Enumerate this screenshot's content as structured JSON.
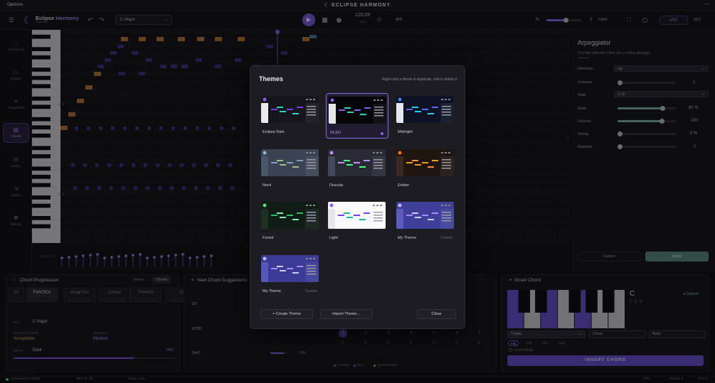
{
  "titlebar": {
    "menu": "Options",
    "title": "ECLIPSE HARMONY",
    "window_controls": "—"
  },
  "toolbar": {
    "app_name_1": "Eclipse",
    "app_name_2": "Harmony",
    "key_select": "C Major",
    "tempo": "120.00",
    "tempo_unit": "BPM",
    "time_signature": "4/4",
    "daw_label": "DAW",
    "vst_label": "VST",
    "sf2_label": "SF2",
    "volume": 0.55
  },
  "sidebar": {
    "items": [
      {
        "label": "Chord Bud",
        "icon": "music-note-icon"
      },
      {
        "label": "Explore",
        "icon": "folder-icon"
      },
      {
        "label": "Progression",
        "icon": "shuffle-icon"
      },
      {
        "label": "Chords",
        "icon": "chords-icon",
        "active": true
      },
      {
        "label": "Scales",
        "icon": "scales-icon"
      },
      {
        "label": "Export",
        "icon": "export-icon"
      },
      {
        "label": "Settings",
        "icon": "gear-icon"
      }
    ]
  },
  "piano_roll": {
    "c_labels": [
      "C4",
      "C3"
    ],
    "velocity_label": "VELOCITY"
  },
  "arpeggiator": {
    "title": "Arpeggiator",
    "subtitle": "Turn the selected chord into a rolling arpeggio.",
    "direction": {
      "label": "Direction",
      "value": "Up"
    },
    "octaves": {
      "label": "Octaves",
      "value": "1",
      "level": 0.0
    },
    "rate": {
      "label": "Rate",
      "value": "1/16"
    },
    "gate": {
      "label": "Gate",
      "value": "80 %",
      "level": 0.8
    },
    "velocity": {
      "label": "Velocity",
      "value": "100",
      "level": 0.79
    },
    "swing": {
      "label": "Swing",
      "value": "0 %",
      "level": 0.0
    },
    "repeats": {
      "label": "Repeats",
      "value": "1",
      "level": 0.0
    },
    "cancel": "Cancel",
    "apply": "Apply"
  },
  "progression": {
    "title": "Chord Progression",
    "tab_voices": "Voices",
    "tab_chords": "Chords",
    "chords": [
      "C#",
      "F#m7/C#",
      "Amaj7/C#",
      "C#sus",
      "F#m/C#",
      "D"
    ],
    "key_label": "KEY",
    "key_value": "C Major",
    "voice_leading_label": "VOICE LEADING",
    "voice_leading_value": "Acceptable",
    "tension_label": "TENSION",
    "tension_value": "Medium",
    "mode_label": "MODE",
    "mode_value": "Dark",
    "mode_pct": "74%",
    "mode_level": 0.74
  },
  "suggestions": {
    "title": "Next Chord Suggestions",
    "rows": [
      {
        "chord": "G7",
        "pct": ""
      },
      {
        "chord": "G7/D",
        "pct": ""
      },
      {
        "chord": "Dm7",
        "pct": "76%",
        "level": 0.76
      }
    ],
    "degrees": [
      "1",
      "2",
      "3",
      "4",
      "5",
      "6",
      "7"
    ],
    "notes": [
      "C",
      "D",
      "E",
      "F",
      "G",
      "A",
      "B"
    ],
    "legend": [
      "In Scale",
      "Root",
      "Selected Note"
    ]
  },
  "smart_chord": {
    "title": "Smart Chord",
    "root": "C",
    "notes": "C E G",
    "diatonic": "Diatonic",
    "type_select": "Triads",
    "voicing_select": "Close",
    "inversion_select": "Root",
    "qualities": [
      "maj",
      "min",
      "dim",
      "aug"
    ],
    "insert_mode": "Insert Mode",
    "insert_button": "INSERT CHORD"
  },
  "themes_modal": {
    "title": "Themes",
    "hint": "Right-click a theme to duplicate, edit or delete it",
    "themes": [
      {
        "name": "Eclipse Dark",
        "bg": "#15151c",
        "side": "#e9e9ee",
        "accent": "#8b5cf6",
        "n1": "#7c3aed",
        "n2": "#2dd4bf",
        "selected": false,
        "custom": ""
      },
      {
        "name": "OLED",
        "bg": "#050507",
        "side": "#e6e6ea",
        "accent": "#8b5cf6",
        "n1": "#8b5cf6",
        "n2": "#2dd4bf",
        "selected": true,
        "custom": ""
      },
      {
        "name": "Midnight",
        "bg": "#0d1324",
        "side": "#e6e8f0",
        "accent": "#3b82f6",
        "n1": "#6366f1",
        "n2": "#22d3ee",
        "selected": false,
        "custom": ""
      },
      {
        "name": "Nord",
        "bg": "#3b4252",
        "side": "#4c566a",
        "accent": "#88c0d0",
        "n1": "#81a1c1",
        "n2": "#a3be8c",
        "selected": false,
        "custom": ""
      },
      {
        "name": "Dracula",
        "bg": "#282a36",
        "side": "#44475a",
        "accent": "#bd93f9",
        "n1": "#bd93f9",
        "n2": "#50fa7b",
        "selected": false,
        "custom": ""
      },
      {
        "name": "Ember",
        "bg": "#1f1612",
        "side": "#3a2a22",
        "accent": "#f97316",
        "n1": "#f59e0b",
        "n2": "#fb923c",
        "selected": false,
        "custom": ""
      },
      {
        "name": "Forest",
        "bg": "#101c16",
        "side": "#1d3026",
        "accent": "#4ade80",
        "n1": "#22c55e",
        "n2": "#86efac",
        "selected": false,
        "custom": ""
      },
      {
        "name": "Light",
        "bg": "#fafafa",
        "side": "#e5e5ea",
        "accent": "#8b5cf6",
        "n1": "#7c3aed",
        "n2": "#14b8a6",
        "selected": false,
        "custom": ""
      },
      {
        "name": "My Theme",
        "bg": "#3f3f9a",
        "side": "#5b5bc0",
        "accent": "#c4b5fd",
        "n1": "#a78bfa",
        "n2": "#c7d2fe",
        "selected": false,
        "custom": "Custom"
      },
      {
        "name": "My Theme",
        "bg": "#3b3b96",
        "side": "#5656bb",
        "accent": "#c4b5fd",
        "n1": "#a78bfa",
        "n2": "#c7d2fe",
        "selected": false,
        "custom": "Custom"
      }
    ],
    "create_button": "+ Create Theme",
    "import_button": "Import Theme…",
    "close_button": "Close"
  },
  "status": {
    "connection": "Connected to DAW",
    "midi": "MIDI In: All",
    "snap": "Snap: Auto",
    "cpu": "CPU",
    "voices": "Voices: 0",
    "version": "v0.5.0"
  },
  "colors": {
    "accent": "#8b5cf6",
    "note_orange": "#b7773a",
    "note_purple": "#4c3d9a",
    "teal": "#7cb8a8"
  }
}
